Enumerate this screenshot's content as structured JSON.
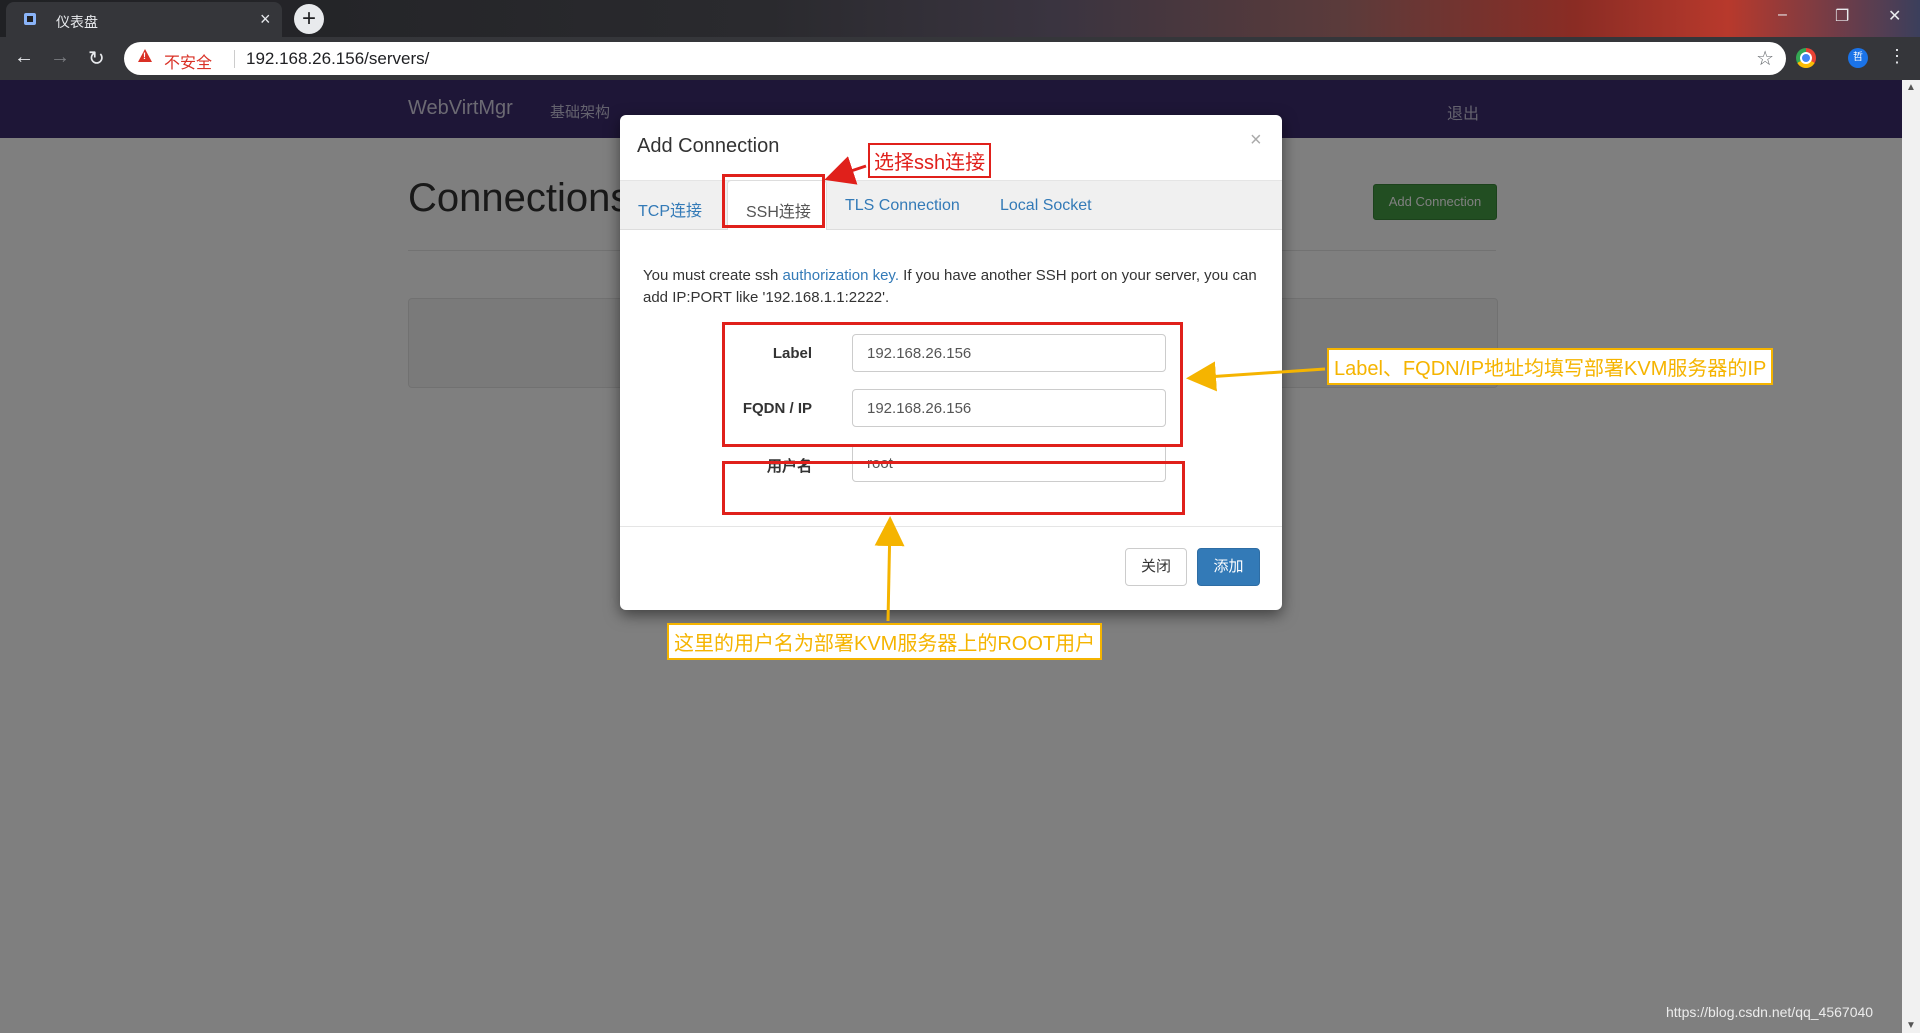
{
  "browser": {
    "tab_title": "仪表盘",
    "tab_close": "×",
    "new_tab": "+",
    "insecure_label": "不安全",
    "url_host": "192.168.26.156",
    "url_path": "/servers/",
    "profile_initial": "哲",
    "window_controls": [
      "–",
      "❐",
      "✕"
    ]
  },
  "navbar": {
    "brand": "WebVirtMgr",
    "infrastructure": "基础架构",
    "logout": "退出"
  },
  "page": {
    "title": "Connections",
    "add_connection": "Add Connection"
  },
  "modal": {
    "title": "Add Connection",
    "close": "×",
    "tabs": [
      "TCP连接",
      "SSH连接",
      "TLS Connection",
      "Local Socket"
    ],
    "active_tab": "SSH连接",
    "help_prefix": "You must create ssh ",
    "help_link": "authorization key.",
    "help_suffix": " If you have another SSH port on your server, you can add IP:PORT like '192.168.1.1:2222'.",
    "fields": [
      {
        "label": "Label",
        "value": "192.168.26.156"
      },
      {
        "label": "FQDN / IP",
        "value": "192.168.26.156"
      },
      {
        "label": "用户名",
        "value": "root"
      }
    ],
    "btn_close": "关闭",
    "btn_add": "添加"
  },
  "annotations": {
    "select_ssh": "选择ssh连接",
    "label_fqdn_note": "Label、FQDN/IP地址均填写部署KVM服务器的IP",
    "username_note": "这里的用户名为部署KVM服务器上的ROOT用户",
    "red_color": "#e0201b",
    "yellow_color": "#f5b400"
  },
  "watermark": "https://blog.csdn.net/qq_4567040"
}
